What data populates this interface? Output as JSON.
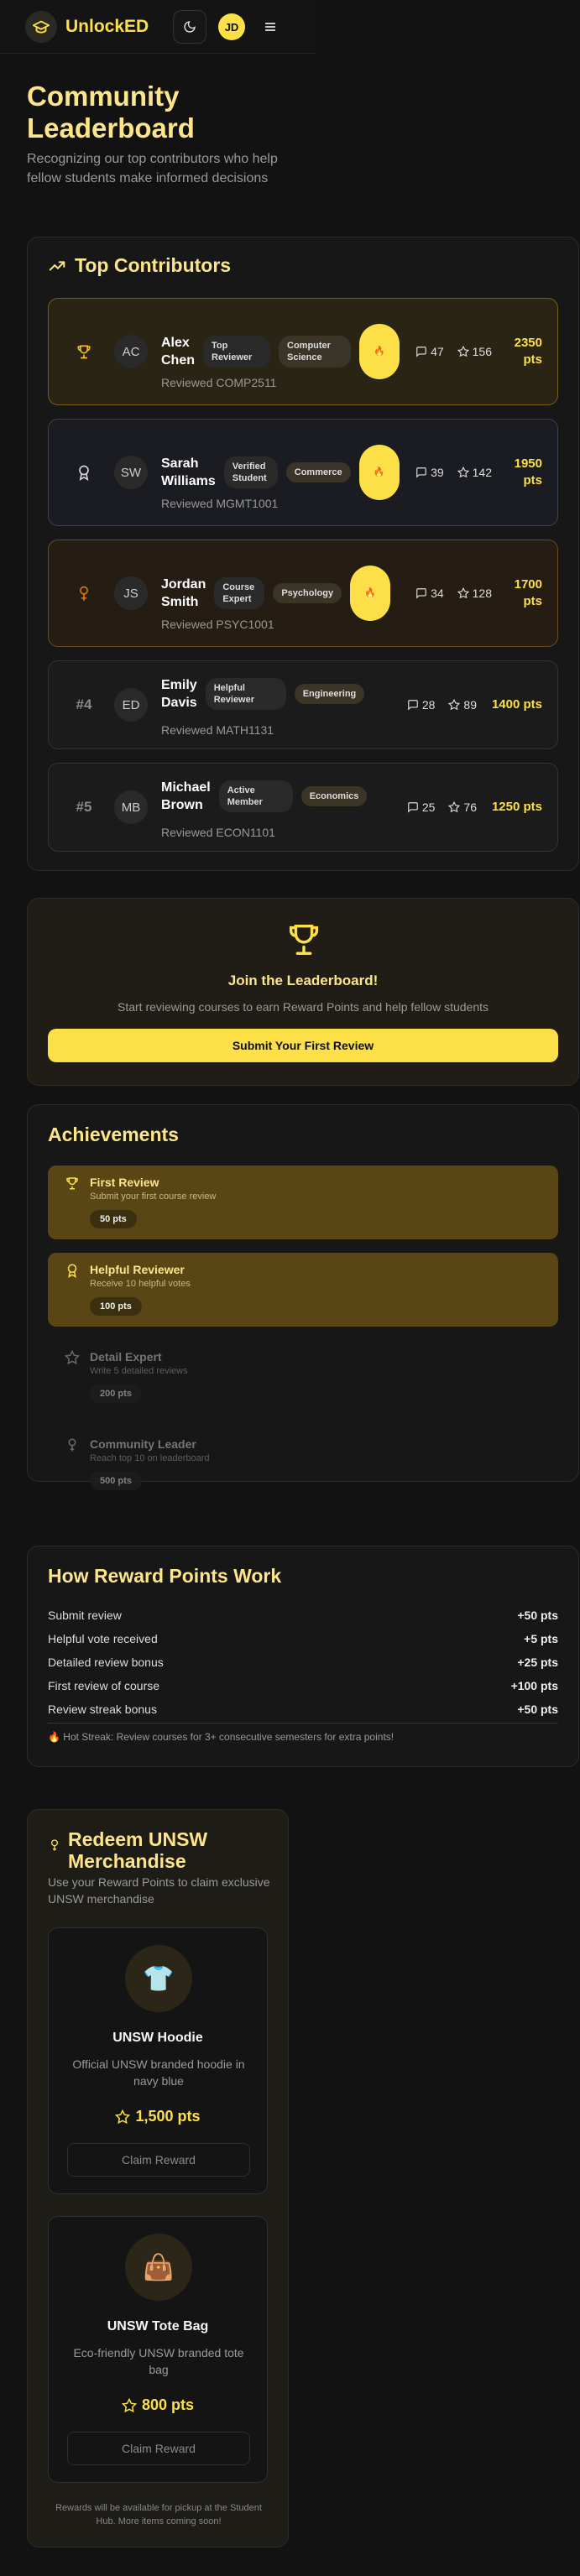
{
  "header": {
    "brand": "UnlockED",
    "avatar_initials": "JD"
  },
  "page": {
    "title": "Community Leaderboard",
    "subtitle": "Recognizing our top contributors who help fellow students make informed decisions"
  },
  "top_contributors": {
    "title": "Top Contributors",
    "rows": [
      {
        "rank": "",
        "initials": "AC",
        "first": "Alex",
        "last": "Chen",
        "badge": "Top Reviewer",
        "faculty": "Computer Science",
        "streak": "",
        "reviewed": "Reviewed COMP2511",
        "comments": "47",
        "stars": "156",
        "points": "2350",
        "unit": "pts"
      },
      {
        "rank": "",
        "initials": "SW",
        "first": "Sarah",
        "last": "Williams",
        "badge": "Verified Student",
        "faculty": "Commerce",
        "streak": "",
        "reviewed": "Reviewed MGMT1001",
        "comments": "39",
        "stars": "142",
        "points": "1950",
        "unit": "pts"
      },
      {
        "rank": "",
        "initials": "JS",
        "first": "Jordan",
        "last": "Smith",
        "badge": "Course Expert",
        "faculty": "Psychology",
        "streak": "",
        "reviewed": "Reviewed PSYC1001",
        "comments": "34",
        "stars": "128",
        "points": "1700",
        "unit": "pts"
      },
      {
        "rank": "#4",
        "initials": "ED",
        "first": "Emily",
        "last": "Davis",
        "badge": "Helpful Reviewer",
        "faculty": "Engineering",
        "streak": "",
        "reviewed": "Reviewed MATH1131",
        "comments": "28",
        "stars": "89",
        "points": "1400 pts",
        "unit": ""
      },
      {
        "rank": "#5",
        "initials": "MB",
        "first": "Michael",
        "last": "Brown",
        "badge": "Active Member",
        "faculty": "Economics",
        "streak": "",
        "reviewed": "Reviewed ECON1101",
        "comments": "25",
        "stars": "76",
        "points": "1250 pts",
        "unit": ""
      }
    ]
  },
  "join": {
    "title": "Join the Leaderboard!",
    "subtitle": "Start reviewing courses to earn Reward Points and help fellow students",
    "button": "Submit Your First Review"
  },
  "achievements": {
    "title": "Achievements",
    "items": [
      {
        "title": "First Review",
        "desc": "Submit your first course review",
        "points": "50 pts",
        "unlocked": true
      },
      {
        "title": "Helpful Reviewer",
        "desc": "Receive 10 helpful votes",
        "points": "100 pts",
        "unlocked": true
      },
      {
        "title": "Detail Expert",
        "desc": "Write 5 detailed reviews",
        "points": "200 pts",
        "unlocked": false
      },
      {
        "title": "Community Leader",
        "desc": "Reach top 10 on leaderboard",
        "points": "500 pts",
        "unlocked": false
      }
    ]
  },
  "reward_rules": {
    "title": "How Reward Points Work",
    "rules": [
      {
        "label": "Submit review",
        "points": "+50 pts"
      },
      {
        "label": "Helpful vote received",
        "points": "+5 pts"
      },
      {
        "label": "Detailed review bonus",
        "points": "+25 pts"
      },
      {
        "label": "First review of course",
        "points": "+100 pts"
      },
      {
        "label": "Review streak bonus",
        "points": "+50 pts"
      }
    ],
    "note": "🔥 Hot Streak: Review courses for 3+ consecutive semesters for extra points!"
  },
  "redeem": {
    "title": "Redeem UNSW Merchandise",
    "subtitle": "Use your Reward Points to claim exclusive UNSW merchandise",
    "products": [
      {
        "icon": "👕",
        "name": "UNSW Hoodie",
        "desc": "Official UNSW branded hoodie in navy blue",
        "price": "1,500 pts",
        "button": "Claim Reward"
      },
      {
        "icon": "👜",
        "name": "UNSW Tote Bag",
        "desc": "Eco-friendly UNSW branded tote bag",
        "price": "800 pts",
        "button": "Claim Reward"
      }
    ],
    "footer": "Rewards will be available for pickup at the Student Hub. More items coming soon!"
  },
  "icons": {
    "brand": "graduation-cap-icon",
    "theme": "moon-icon",
    "menu": "hamburger-menu-icon",
    "contributors_heading": "trending-up-icon",
    "rank_1": "trophy-icon",
    "rank_2": "award-icon",
    "rank_3": "medal-icon",
    "comments": "message-icon",
    "stars": "star-icon"
  },
  "colors": {
    "accent": "#fde047",
    "heading": "#fde68a",
    "background": "#121212"
  }
}
